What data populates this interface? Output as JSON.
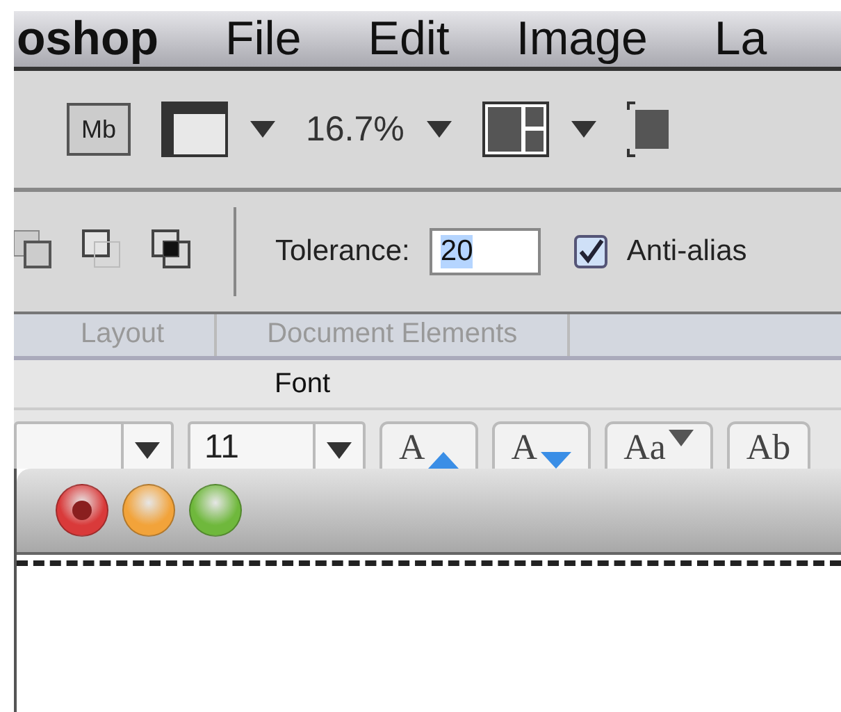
{
  "menu_bar": {
    "items": [
      "oshop",
      "File",
      "Edit",
      "Image",
      "La"
    ]
  },
  "app_bar": {
    "bridge_button": "Mb",
    "zoom": "16.7%"
  },
  "options_bar": {
    "tolerance": {
      "label": "Tolerance:",
      "value": "20"
    },
    "anti_alias": {
      "label": "Anti-alias",
      "checked": true
    }
  },
  "ribbon": {
    "tabs": [
      {
        "label": "Layout",
        "selected": false
      },
      {
        "label": "Document Elements",
        "selected": false
      }
    ],
    "group_title": "Font",
    "font_size": "11",
    "grow_label": "A",
    "shrink_label": "A",
    "case_label": "Aa",
    "style_label": "Ab"
  },
  "document_window": {
    "buttons": [
      {
        "kind": "close",
        "color": "#d93a3a"
      },
      {
        "kind": "minimize",
        "color": "#f2a33a"
      },
      {
        "kind": "zoom",
        "color": "#6fb83c"
      }
    ]
  }
}
